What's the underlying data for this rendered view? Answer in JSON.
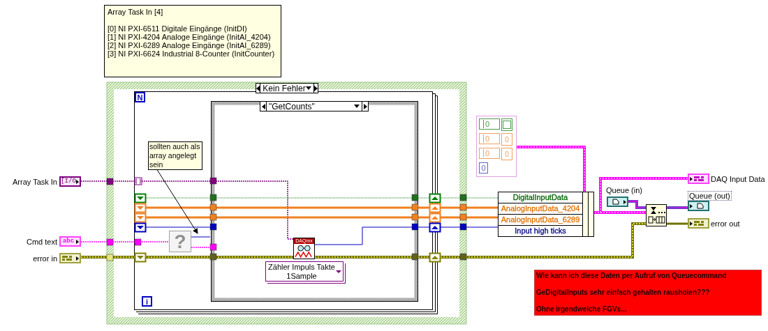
{
  "comment": {
    "title": "Array Task In [4]",
    "lines": [
      "[0] NI PXI-6511 Digitale Eingänge (InitDI)",
      "[1] NI PXI-4204 Analoge Eingänge (InitAI_4204)",
      "[2] NI PXI-6289 Analoge Eingänge (InitAI_6289)",
      "[3] NI PXI-6624 Industrial 8-Counter (InitCounter)"
    ]
  },
  "case_structure": {
    "selector": "Kein Fehler"
  },
  "for_loop": {
    "count_terminal": "N",
    "iteration_terminal": "i"
  },
  "inner_case_structure": {
    "selector": "\"GetCounts\""
  },
  "note": "sollten auch als array angelegt sein",
  "inputs": [
    {
      "label": "Array Task In",
      "kind": "io",
      "glyph": "[I/O"
    },
    {
      "label": "Cmd text",
      "kind": "string",
      "glyph": "abc"
    },
    {
      "label": "error in",
      "kind": "error"
    }
  ],
  "unknown_node": {
    "glyph": "?"
  },
  "daqmx_node": {
    "header": "DAQmx",
    "selector": "Zähler Impuls Takte 1Sample"
  },
  "cluster_constant": {
    "rows": [
      {
        "kind": "numeric-bool",
        "value": "0",
        "color": "#4c9a4c"
      },
      {
        "kind": "numeric-array",
        "value": "0",
        "array_value": "0",
        "color": "#f0a060"
      },
      {
        "kind": "numeric-array",
        "value": "0",
        "array_value": "0",
        "color": "#f0a060"
      },
      {
        "kind": "numeric",
        "value": "0",
        "color": "#6060d0"
      }
    ]
  },
  "bundle": {
    "items": [
      {
        "label": "DigitalInputData",
        "color": "#006400"
      },
      {
        "label": "AnalogInputData_4204",
        "color": "#e07000"
      },
      {
        "label": "AnalogInputData_6289",
        "color": "#e07000"
      },
      {
        "label": "Input high ticks",
        "color": "#000080"
      }
    ]
  },
  "queue_in": {
    "label": "Queue (in)",
    "kind": "queue"
  },
  "outputs": [
    {
      "label": "DAQ Input Data",
      "kind": "cluster"
    },
    {
      "label": "Queue (out)",
      "kind": "queue"
    },
    {
      "label": "error out",
      "kind": "error"
    }
  ],
  "question": [
    "Wie kann ich diese Daten per Aufruf von Queuecommand",
    "GeDigitalInputs sehr einfach gehalten rausholen???",
    "Ohne irgendwelche FGVs..."
  ]
}
